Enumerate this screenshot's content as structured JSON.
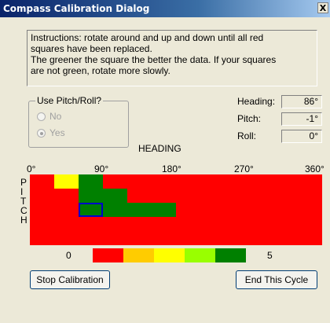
{
  "window": {
    "title": "Compass Calibration Dialog",
    "close_glyph": "X"
  },
  "instructions": [
    "Instructions: rotate around and up and down until all red",
    "squares have been replaced.",
    "The greener the square the better the data.  If your squares",
    "are not green, rotate more slowly."
  ],
  "pitch_roll": {
    "legend": "Use Pitch/Roll?",
    "options": [
      {
        "label": "No",
        "checked": false,
        "enabled": false
      },
      {
        "label": "Yes",
        "checked": true,
        "enabled": false
      }
    ]
  },
  "readouts": [
    {
      "label": "Heading:",
      "value": "86°"
    },
    {
      "label": "Pitch:",
      "value": "-1°"
    },
    {
      "label": "Roll:",
      "value": "0°"
    }
  ],
  "grid": {
    "title": "HEADING",
    "heading_ticks": [
      "0°",
      "90°",
      "180°",
      "270°",
      "360°"
    ],
    "pitch_letters": [
      "P",
      "I",
      "T",
      "C",
      "H"
    ],
    "columns": 12,
    "rows": 4,
    "cells": [
      {
        "col": 1,
        "row": 0,
        "level": 2
      },
      {
        "col": 2,
        "row": 0,
        "level": 4
      },
      {
        "col": 2,
        "row": 1,
        "level": 4
      },
      {
        "col": 3,
        "row": 1,
        "level": 4
      },
      {
        "col": 2,
        "row": 2,
        "level": 4
      },
      {
        "col": 3,
        "row": 2,
        "level": 4
      },
      {
        "col": 4,
        "row": 2,
        "level": 4
      },
      {
        "col": 5,
        "row": 2,
        "level": 4
      }
    ],
    "current_cell": {
      "col": 2,
      "row": 2
    }
  },
  "quality_scale": {
    "min_label": "0",
    "max_label": "5",
    "colors": [
      "#ff0000",
      "#ffcc00",
      "#ffff00",
      "#99ff00",
      "#008000"
    ]
  },
  "buttons": {
    "stop": "Stop Calibration",
    "end": "End This Cycle"
  }
}
